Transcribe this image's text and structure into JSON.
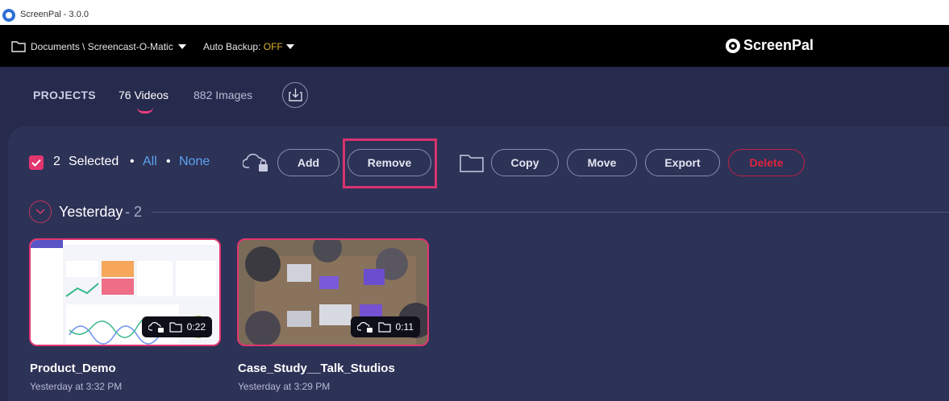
{
  "window": {
    "title": "ScreenPal - 3.0.0"
  },
  "menubar": {
    "path": "Documents \\ Screencast-O-Matic",
    "backup_label": "Auto Backup:",
    "backup_value": "OFF",
    "logo_text": "ScreenPal"
  },
  "tabs": {
    "projects": "PROJECTS",
    "videos": "76 Videos",
    "images": "882 Images"
  },
  "toolbar": {
    "selected_count": "2",
    "selected_label": "Selected",
    "separator": "•",
    "all": "All",
    "none": "None",
    "add": "Add",
    "remove": "Remove",
    "copy": "Copy",
    "move": "Move",
    "export": "Export",
    "delete": "Delete"
  },
  "section": {
    "title": "Yesterday",
    "count": "- 2"
  },
  "videos": [
    {
      "name": "Product_Demo",
      "date": "Yesterday at 3:32 PM",
      "duration": "0:22"
    },
    {
      "name": "Case_Study__Talk_Studios",
      "date": "Yesterday at 3:29 PM",
      "duration": "0:11"
    }
  ],
  "colors": {
    "accent": "#e2356f",
    "link": "#5aa4f0",
    "backup_off": "#e0b42e",
    "delete": "#e0243f"
  }
}
